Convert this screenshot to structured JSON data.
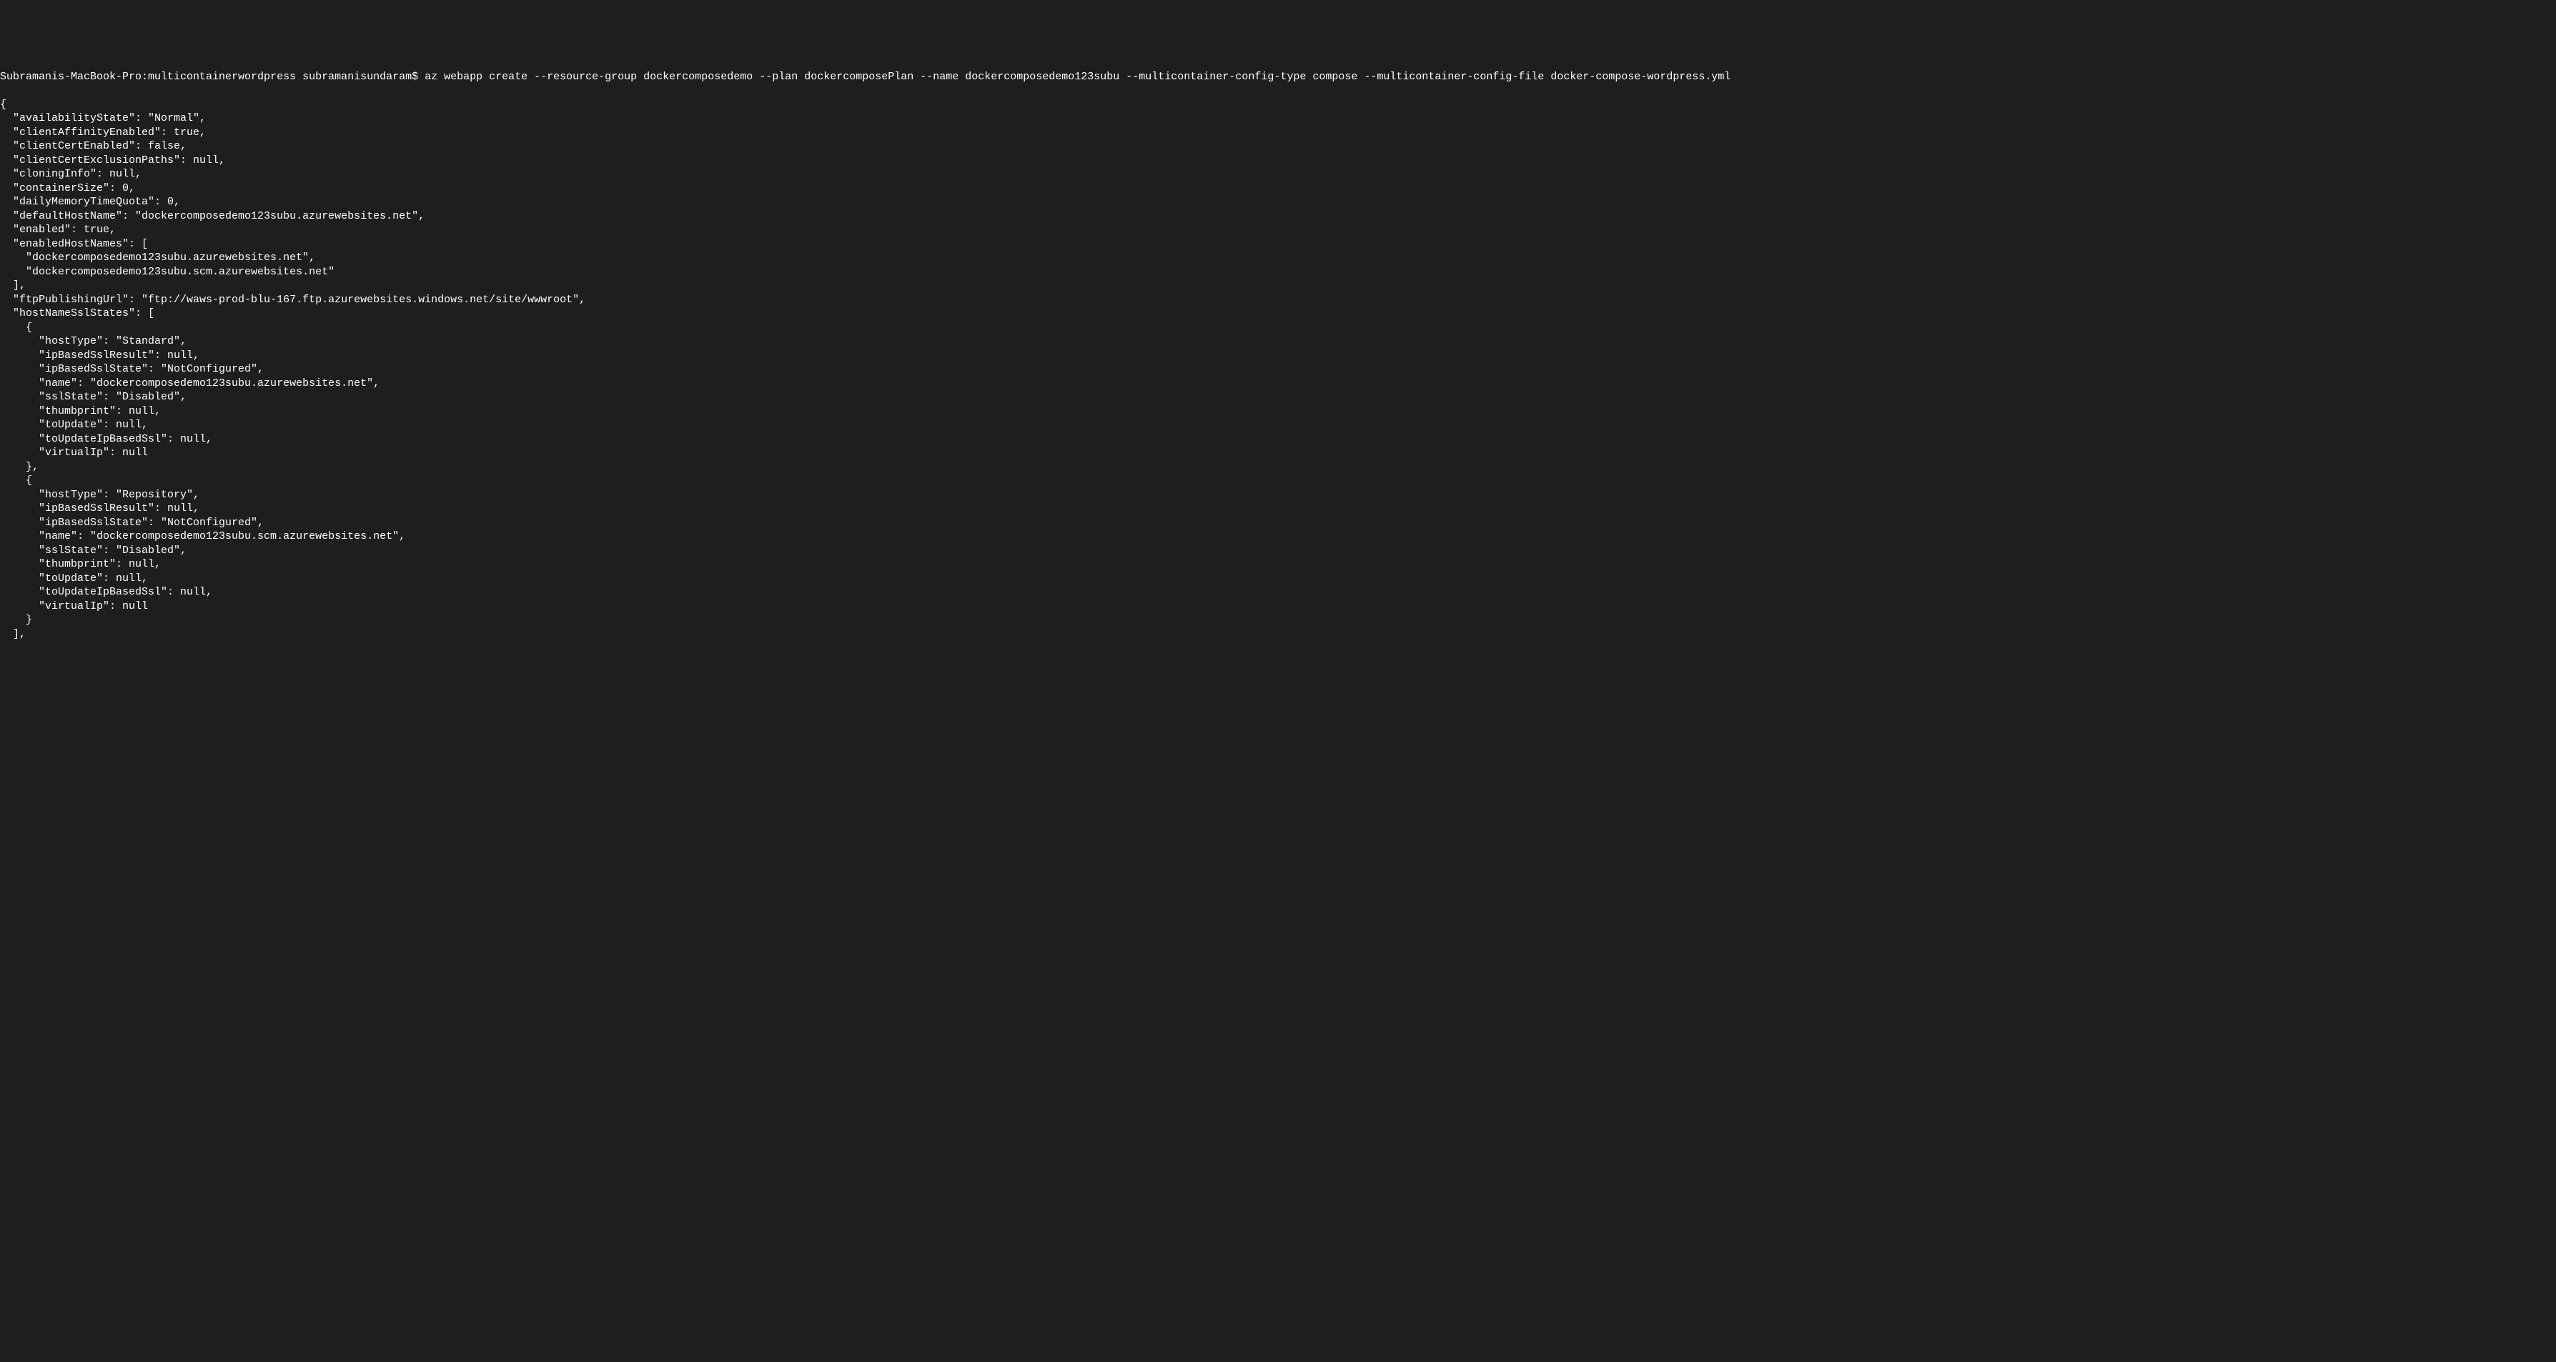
{
  "terminal": {
    "prompt": "Subramanis-MacBook-Pro:multicontainerwordpress subramanisundaram$",
    "command": "az webapp create --resource-group dockercomposedemo --plan dockercomposePlan --name dockercomposedemo123subu --multicontainer-config-type compose --multicontainer-config-file docker-compose-wordpress.yml",
    "output_lines": [
      "{",
      "  \"availabilityState\": \"Normal\",",
      "  \"clientAffinityEnabled\": true,",
      "  \"clientCertEnabled\": false,",
      "  \"clientCertExclusionPaths\": null,",
      "  \"cloningInfo\": null,",
      "  \"containerSize\": 0,",
      "  \"dailyMemoryTimeQuota\": 0,",
      "  \"defaultHostName\": \"dockercomposedemo123subu.azurewebsites.net\",",
      "  \"enabled\": true,",
      "  \"enabledHostNames\": [",
      "    \"dockercomposedemo123subu.azurewebsites.net\",",
      "    \"dockercomposedemo123subu.scm.azurewebsites.net\"",
      "  ],",
      "  \"ftpPublishingUrl\": \"ftp://waws-prod-blu-167.ftp.azurewebsites.windows.net/site/wwwroot\",",
      "  \"hostNameSslStates\": [",
      "    {",
      "      \"hostType\": \"Standard\",",
      "      \"ipBasedSslResult\": null,",
      "      \"ipBasedSslState\": \"NotConfigured\",",
      "      \"name\": \"dockercomposedemo123subu.azurewebsites.net\",",
      "      \"sslState\": \"Disabled\",",
      "      \"thumbprint\": null,",
      "      \"toUpdate\": null,",
      "      \"toUpdateIpBasedSsl\": null,",
      "      \"virtualIp\": null",
      "    },",
      "    {",
      "      \"hostType\": \"Repository\",",
      "      \"ipBasedSslResult\": null,",
      "      \"ipBasedSslState\": \"NotConfigured\",",
      "      \"name\": \"dockercomposedemo123subu.scm.azurewebsites.net\",",
      "      \"sslState\": \"Disabled\",",
      "      \"thumbprint\": null,",
      "      \"toUpdate\": null,",
      "      \"toUpdateIpBasedSsl\": null,",
      "      \"virtualIp\": null",
      "    }",
      "  ],"
    ]
  }
}
